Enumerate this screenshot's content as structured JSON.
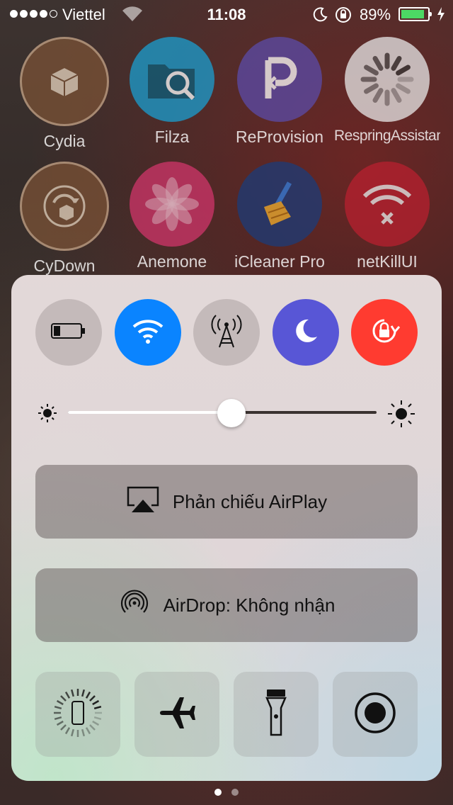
{
  "status_bar": {
    "carrier": "Viettel",
    "time": "11:08",
    "battery_percent": "89%",
    "battery_level": 0.89,
    "signal_bars_filled": 4,
    "signal_bars_total": 5
  },
  "apps": [
    {
      "label": "Cydia",
      "color": "#7a5236"
    },
    {
      "label": "Filza",
      "color": "#1a9ed0"
    },
    {
      "label": "ReProvision",
      "color": "#5b4ba8"
    },
    {
      "label": "RespringAssistant",
      "color": "#e8e8e8"
    },
    {
      "label": "CyDown",
      "color": "#7a5236"
    },
    {
      "label": "Anemone",
      "color": "#d0356a"
    },
    {
      "label": "iCleaner Pro",
      "color": "#1c3c78"
    },
    {
      "label": "netKillUI",
      "color": "#b8202f"
    }
  ],
  "control_center": {
    "toggles": [
      {
        "name": "battery",
        "icon": "battery-icon",
        "active": false
      },
      {
        "name": "wifi",
        "icon": "wifi-icon",
        "active": true,
        "color": "#0a84ff"
      },
      {
        "name": "cellular",
        "icon": "cellular-tower-icon",
        "active": false
      },
      {
        "name": "do-not-disturb",
        "icon": "moon-icon",
        "active": true,
        "color": "#5856d6"
      },
      {
        "name": "rotation-lock",
        "icon": "rotation-lock-icon",
        "active": true,
        "color": "#ff3b30"
      }
    ],
    "brightness": 0.53,
    "airplay_label": "Phản chiếu AirPlay",
    "airdrop_label": "AirDrop: Không nhận",
    "quick_actions": [
      {
        "name": "phone-loading",
        "icon": "phone-spinner-icon"
      },
      {
        "name": "airplane",
        "icon": "airplane-icon"
      },
      {
        "name": "flashlight",
        "icon": "flashlight-icon"
      },
      {
        "name": "record",
        "icon": "record-icon"
      }
    ]
  },
  "page_indicator": {
    "count": 2,
    "current": 1
  }
}
